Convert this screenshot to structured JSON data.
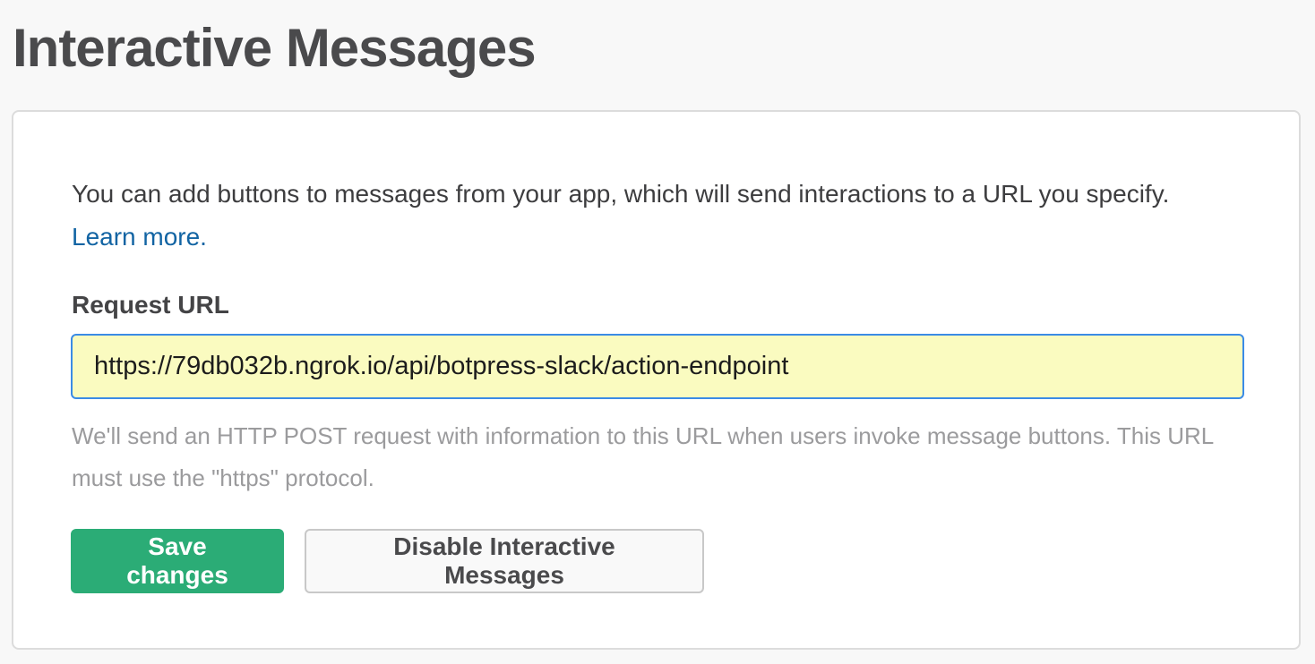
{
  "page": {
    "title": "Interactive Messages"
  },
  "card": {
    "description": "You can add buttons to messages from your app, which will send interactions to a URL you specify.",
    "learn_more_label": "Learn more.",
    "request_url": {
      "label": "Request URL",
      "value": "https://79db032b.ngrok.io/api/botpress-slack/action-endpoint",
      "help_text": "We'll send an HTTP POST request with information to this URL when users invoke message buttons. This URL must use the \"https\" protocol."
    },
    "buttons": {
      "save_label": "Save changes",
      "disable_label": "Disable Interactive Messages"
    }
  },
  "colors": {
    "primary_button": "#2bac76",
    "link": "#1264a3",
    "input_background": "#fafbc0",
    "input_focus_border": "#3a8be6"
  }
}
